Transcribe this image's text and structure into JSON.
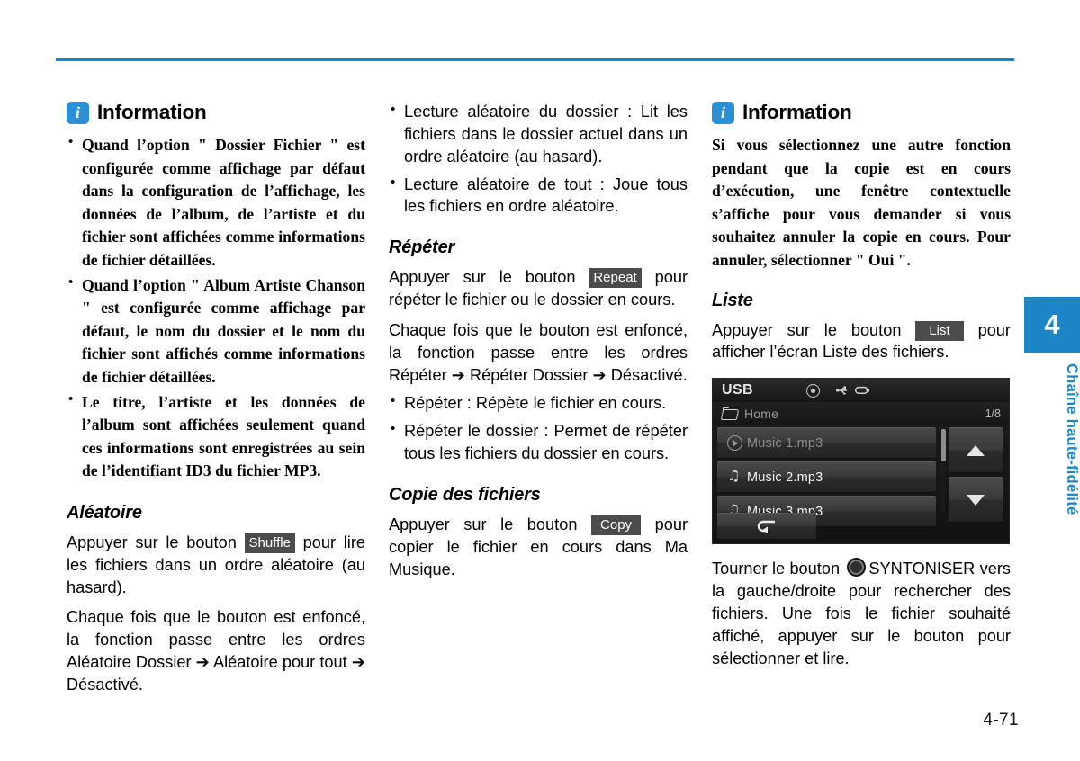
{
  "page": {
    "number": "4-71",
    "rule_color": "#1b85c8"
  },
  "chapter_tab": {
    "number": "4",
    "label": "Chaîne haute-fidélité",
    "color": "#1b85c8"
  },
  "column_1": {
    "info": {
      "badge": "i",
      "title": "Information",
      "bullets": [
        "Quand l’option \" Dossier Fichier \" est configurée comme affichage par défaut dans la configuration de l’affichage, les données de l’album, de l’artiste et du fichier sont affichées comme informations de fichier détaillées.",
        "Quand l’option \" Album Artiste Chanson \" est configurée comme affichage par défaut, le nom du dossier et le nom du fichier sont affichés comme informations de fichier détaillées.",
        "Le titre, l’artiste et les données de l’album sont affichées seulement quand ces informations sont enregistrées au sein de l’identifiant ID3 du fichier MP3."
      ]
    },
    "aleatoire": {
      "heading": "Aléatoire",
      "para1_before": "Appuyer sur le bouton",
      "button_label": "Shuffle",
      "para1_after": "pour lire les fichiers dans un ordre aléatoire (au hasard).",
      "para2": "Chaque fois que le bouton est enfoncé, la fonction passe entre les ordres Aléatoire Dossier ➔ Aléatoire pour tout ➔ Désactivé."
    }
  },
  "column_2": {
    "shuffle_modes": [
      "Lecture aléatoire du dossier : Lit les fichiers dans le dossier actuel dans un ordre aléatoire (au hasard).",
      "Lecture aléatoire de tout : Joue tous les fichiers en ordre aléatoire."
    ],
    "repeter": {
      "heading": "Répéter",
      "para1_before": "Appuyer sur le bouton",
      "button_label": "Repeat",
      "para1_after": "pour répéter le fichier ou le dossier en cours.",
      "para2": "Chaque fois que le bouton est enfoncé, la fonction passe entre les ordres Répéter ➔ Répéter Dossier ➔ Désactivé.",
      "bullets": [
        "Répéter : Répète le fichier en cours.",
        "Répéter le dossier : Permet de répéter tous les fichiers du dossier en cours."
      ]
    },
    "copie": {
      "heading": "Copie des fichiers",
      "para1_before": "Appuyer sur le bouton",
      "button_label": "Copy",
      "para1_after": "pour copier le fichier en cours dans Ma Musique."
    }
  },
  "column_3": {
    "info": {
      "badge": "i",
      "title": "Information",
      "body": "Si vous sélectionnez une autre fonction pendant que la copie est en cours d’exécution, une fenêtre contextuelle s’affiche pour vous demander si vous souhaitez annuler la copie en cours. Pour annuler, sélectionner \" Oui \"."
    },
    "liste": {
      "heading": "Liste",
      "para1_before": "Appuyer sur le bouton",
      "button_label": "List",
      "para1_after": "pour afficher l’écran Liste des fichiers."
    },
    "usb_screen": {
      "title": "USB",
      "top_icons": [
        "disc-icon",
        "usb-icon",
        "usb-stick-icon"
      ],
      "path": "Home",
      "page_indicator": "1/8",
      "rows": [
        {
          "label": "Music 1.mp3",
          "icon": "play-circle-icon",
          "state": "playing"
        },
        {
          "label": "Music 2.mp3",
          "icon": "music-note-icon",
          "state": "normal"
        },
        {
          "label": "Music 3.mp3",
          "icon": "music-note-icon",
          "state": "normal"
        }
      ],
      "scroll_up": "▲",
      "scroll_down": "▼",
      "back_button": "↰"
    },
    "tuner": {
      "before": "Tourner le bouton",
      "knob_label": "SYNTONISER",
      "after": "vers la gauche/droite pour rechercher des fichiers. Une fois le fichier souhaité affiché, appuyer sur le bouton pour sélectionner et lire."
    }
  }
}
